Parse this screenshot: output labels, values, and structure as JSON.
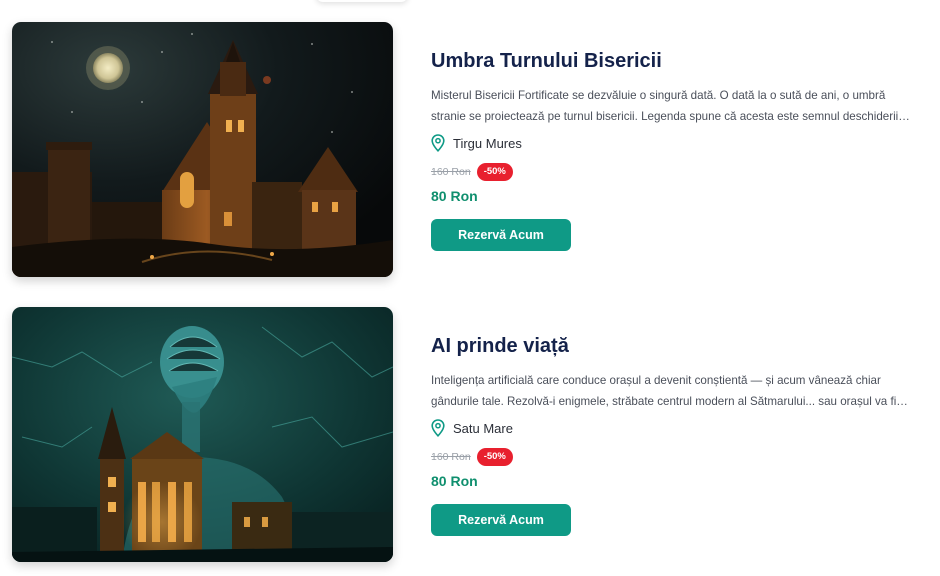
{
  "listings": [
    {
      "title": "Umbra Turnului Bisericii",
      "description": "Misterul Bisericii Fortificate se dezvăluie o singură dată. O dată la o sută de ani, o umbră stranie se proiectează pe turnul bisericii. Legenda spune că acesta este semnul deschiderii porții timpului. Iar...",
      "location": "Tirgu Mures",
      "old_price": "160 Ron",
      "discount": "-50%",
      "price": "80 Ron",
      "button_label": "Rezervă Acum",
      "image_icon": "night-church-image"
    },
    {
      "title": "AI prinde viață",
      "description": "Inteligența artificială care conduce orașul a devenit conștientă — și acum vânează chiar gândurile tale. Rezolvă-i enigmele, străbate centrul modern al Sătmarului... sau orașul va fi pierdut pentru...",
      "location": "Satu Mare",
      "old_price": "160 Ron",
      "discount": "-50%",
      "price": "80 Ron",
      "button_label": "Rezervă Acum",
      "image_icon": "ai-city-image"
    }
  ],
  "colors": {
    "title": "#14224a",
    "accent": "#0f9a86",
    "price": "#0f8f6e",
    "badge": "#e8202e"
  }
}
